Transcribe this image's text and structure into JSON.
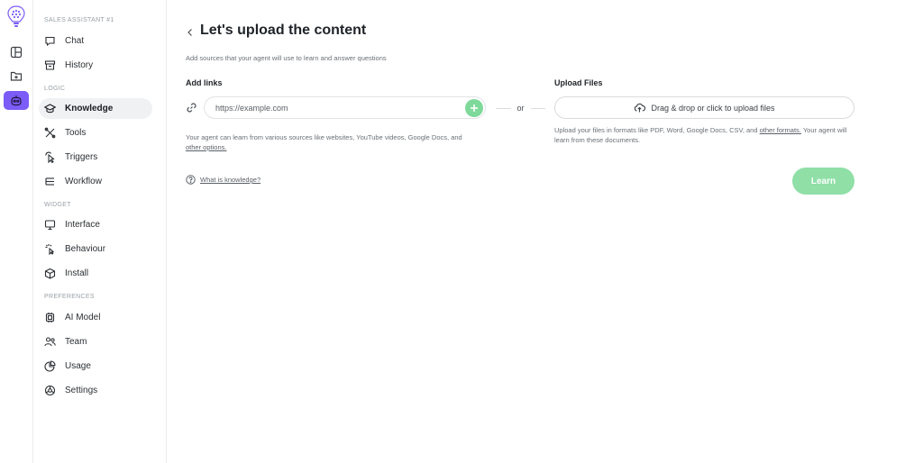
{
  "rail": {
    "items": [
      {
        "icon": "layout-icon"
      },
      {
        "icon": "folder-plus-icon"
      },
      {
        "icon": "robot-icon",
        "active": true
      }
    ]
  },
  "sidebar": {
    "agent_label": "SALES ASSISTANT #1",
    "sections": {
      "logic": "LOGIC",
      "widget": "WIDGET",
      "preferences": "PREFERENCES"
    },
    "items": {
      "chat": "Chat",
      "history": "History",
      "knowledge": "Knowledge",
      "tools": "Tools",
      "triggers": "Triggers",
      "workflow": "Workflow",
      "interface": "Interface",
      "behaviour": "Behaviour",
      "install": "Install",
      "ai_model": "AI Model",
      "team": "Team",
      "usage": "Usage",
      "settings": "Settings"
    }
  },
  "main": {
    "title": "Let's upload the content",
    "subtitle": "Add sources that your agent will use to learn and answer questions",
    "links": {
      "heading": "Add links",
      "placeholder": "https://example.com",
      "help_text": "Your agent can learn from various sources like websites, YouTube videos, Google Docs, and",
      "help_link": "other options."
    },
    "or_label": "or",
    "files": {
      "heading": "Upload Files",
      "dropzone_label": "Drag & drop or click to upload files",
      "help_text_1": "Upload your files in formats like PDF, Word, Google Docs, CSV, and",
      "help_link": "other formats.",
      "help_text_2": "Your agent will learn from these documents."
    },
    "what_is_knowledge": "What is knowledge?",
    "learn_button": "Learn"
  },
  "colors": {
    "accent": "#7c5cf6",
    "green": "#7ed99a",
    "learn_button": "#8fdfa7"
  }
}
